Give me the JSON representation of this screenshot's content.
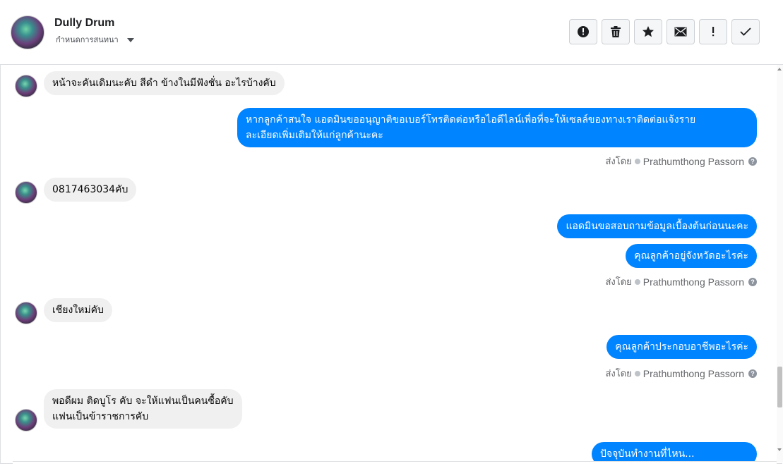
{
  "header": {
    "contact_name": "Dully Drum",
    "conversation_setting": "กำหนดการสนทนา",
    "actions": [
      {
        "icon": "alert-circle-icon",
        "tooltip": ""
      },
      {
        "icon": "trash-icon",
        "tooltip": ""
      },
      {
        "icon": "star-icon",
        "tooltip": ""
      },
      {
        "icon": "envelope-icon",
        "tooltip": ""
      },
      {
        "icon": "exclamation-icon",
        "tooltip": ""
      },
      {
        "icon": "check-icon",
        "tooltip": ""
      }
    ]
  },
  "messages": [
    {
      "from": "customer",
      "text": "หน้าจะคันเดิมนะคับ สีดำ ข้างในมีฟังชั่น อะไรบ้างคับ"
    },
    {
      "from": "page",
      "lines": [
        "หากลูกค้าสนใจ แอดมินขออนุญาติขอเบอร์โทรติดต่อหรือไอดีไลน์เพื่อที่จะให้เซลล์ของทางเราติดต่อแจ้งราย",
        "ละเอียดเพิ่มเติมให้แก่ลูกค้านะคะ"
      ]
    },
    {
      "from": "customer",
      "text": "0817463034คับ"
    },
    {
      "from": "page",
      "text": "แอดมินขอสอบถามข้อมูลเบื้องต้นก่อนนะคะ"
    },
    {
      "from": "page",
      "text": "คุณลูกค้าอยู่จังหวัดอะไรค่ะ"
    },
    {
      "from": "customer",
      "text": "เชียงใหม่คับ"
    },
    {
      "from": "page",
      "text": "คุณลูกค้าประกอบอาชีพอะไรค่ะ"
    },
    {
      "from": "customer",
      "lines": [
        "พอดีผม ติดบูโร คับ จะให้แฟนเป็นคนซื้อคับ",
        "แฟนเป็นข้าราชการคับ"
      ]
    },
    {
      "from": "page",
      "text": "ปัจจุบันทำงานที่ไหน..."
    }
  ],
  "sent_by": {
    "label": "ส่งโดย",
    "agent": "Prathumthong Passorn",
    "help": "?"
  },
  "colors": {
    "outgoing_bubble": "#0084ff",
    "incoming_bubble": "#f0f0f0",
    "muted_text": "#65676b"
  }
}
